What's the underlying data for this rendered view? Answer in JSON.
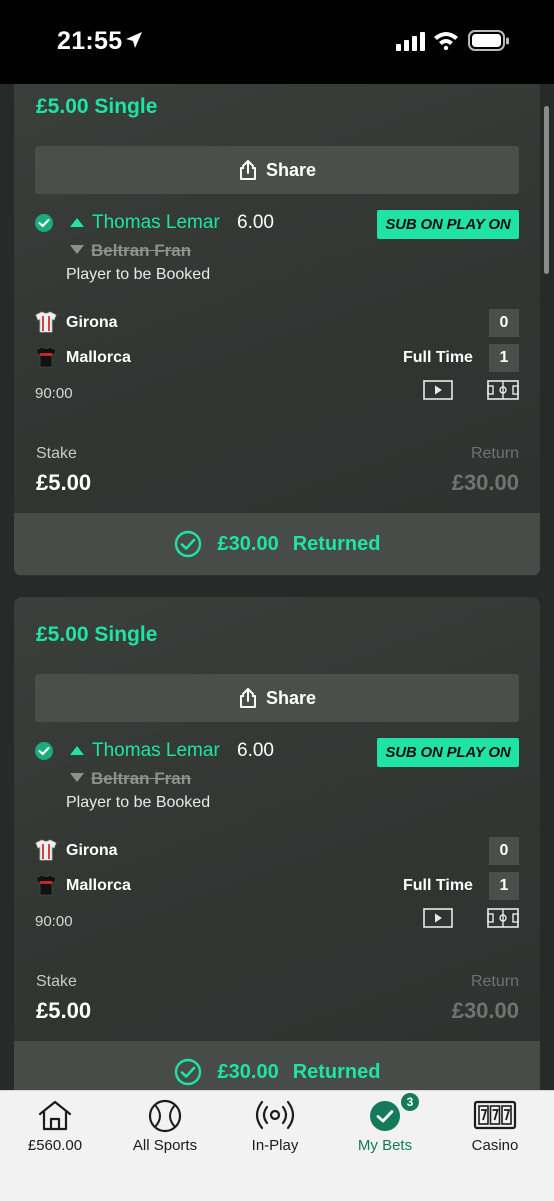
{
  "status_bar": {
    "time": "21:55"
  },
  "bets": [
    {
      "title": "£5.00 Single",
      "share_label": "Share",
      "selection": "Thomas Lemar",
      "odds": "6.00",
      "badge": "SUB ON PLAY ON",
      "removed_selection": "Beltran Fran",
      "market": "Player to be Booked",
      "home_team": "Girona",
      "home_score": "0",
      "away_team": "Mallorca",
      "away_score": "1",
      "match_status": "Full Time",
      "clock": "90:00",
      "stake_label": "Stake",
      "stake": "£5.00",
      "return_label": "Return",
      "return": "£30.00",
      "returned_amount": "£30.00",
      "returned_label": "Returned"
    },
    {
      "title": "£5.00 Single",
      "share_label": "Share",
      "selection": "Thomas Lemar",
      "odds": "6.00",
      "badge": "SUB ON PLAY ON",
      "removed_selection": "Beltran Fran",
      "market": "Player to be Booked",
      "home_team": "Girona",
      "home_score": "0",
      "away_team": "Mallorca",
      "away_score": "1",
      "match_status": "Full Time",
      "clock": "90:00",
      "stake_label": "Stake",
      "stake": "£5.00",
      "return_label": "Return",
      "return": "£30.00",
      "returned_amount": "£30.00",
      "returned_label": "Returned"
    }
  ],
  "bottom_nav": {
    "items": [
      {
        "label": "£560.00",
        "icon": "home-icon"
      },
      {
        "label": "All Sports",
        "icon": "ball-icon"
      },
      {
        "label": "In-Play",
        "icon": "live-broadcast-icon"
      },
      {
        "label": "My Bets",
        "icon": "check-circle-icon",
        "badge": "3",
        "active": true
      },
      {
        "label": "Casino",
        "icon": "slot-machine-icon"
      }
    ]
  },
  "colors": {
    "accent": "#1fe3a4",
    "background": "#262a28",
    "card": "#333835",
    "nav_active": "#147a5a"
  }
}
